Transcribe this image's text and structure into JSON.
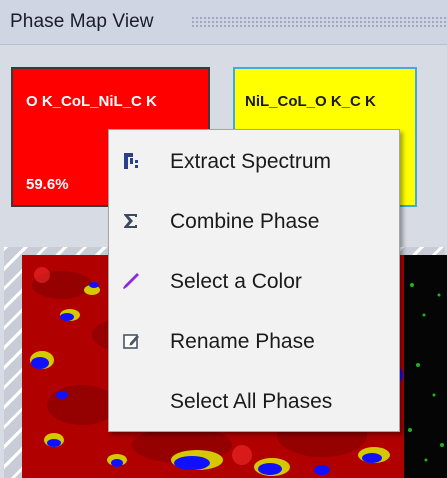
{
  "window": {
    "title": "Phase Map View"
  },
  "phases": [
    {
      "name": "O K_CoL_NiL_C K",
      "percent": "59.6%",
      "color": "#ff0000"
    },
    {
      "name": "NiL_CoL_O K_C K",
      "percent": "",
      "color": "#ffff00"
    }
  ],
  "context_menu": {
    "items": [
      {
        "label": "Extract Spectrum",
        "icon": "extract-spectrum-icon"
      },
      {
        "label": "Combine Phase",
        "icon": "sigma-icon"
      },
      {
        "label": "Select a Color",
        "icon": "color-brush-icon"
      },
      {
        "label": "Rename Phase",
        "icon": "rename-edit-icon"
      },
      {
        "label": "Select All Phases",
        "icon": ""
      }
    ]
  },
  "colors": {
    "phase_red": "#ff0000",
    "phase_yellow": "#ffff00",
    "phase_blue": "#1010ff",
    "selection_border": "#3fa9e0",
    "icon_blue": "#2b3f8f",
    "icon_purple": "#8a2be2"
  }
}
